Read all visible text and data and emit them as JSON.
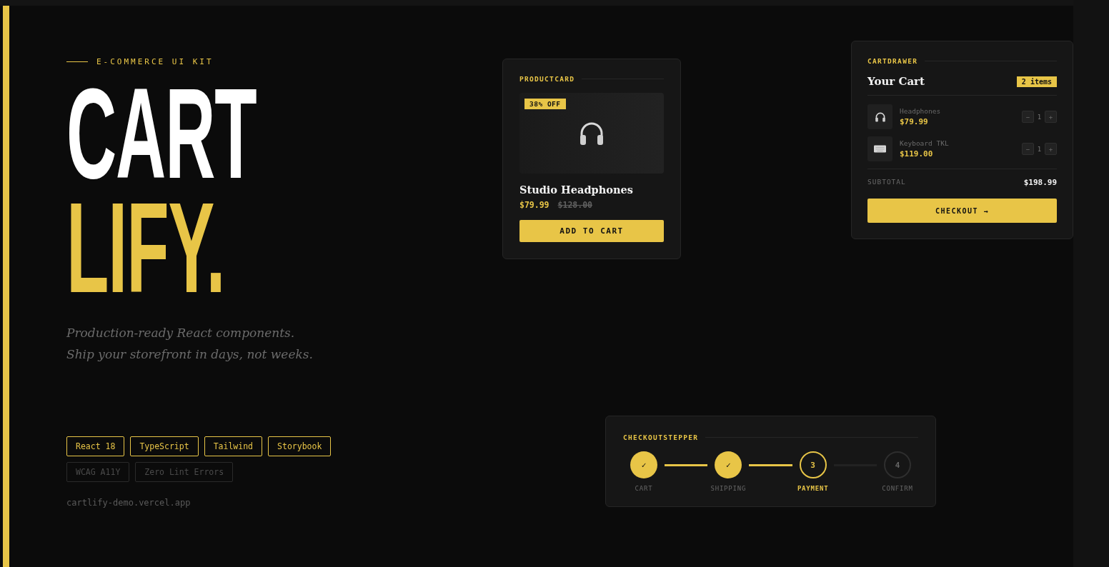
{
  "hero": {
    "eyebrow": "E-COMMERCE UI KIT",
    "title_lines": [
      {
        "text": "CART",
        "accent": false
      },
      {
        "text": "LIFY.",
        "accent": true
      }
    ],
    "tagline_lines": [
      "Production-ready React components.",
      "Ship your storefront in days, not weeks."
    ],
    "tags": [
      {
        "label": "React 18",
        "highlighted": true
      },
      {
        "label": "TypeScript",
        "highlighted": true
      },
      {
        "label": "Tailwind",
        "highlighted": true
      },
      {
        "label": "Storybook",
        "highlighted": true
      },
      {
        "label": "WCAG A11Y",
        "highlighted": false
      },
      {
        "label": "Zero Lint Errors",
        "highlighted": false
      }
    ],
    "url": "cartlify-demo.vercel.app"
  },
  "product_card": {
    "label": "PRODUCTCARD",
    "badge": "38% OFF",
    "name": "Studio Headphones",
    "price": "$79.99",
    "old_price": "$128.00",
    "button": "ADD TO CART"
  },
  "cart_drawer": {
    "label": "CARTDRAWER",
    "title": "Your Cart",
    "count": "2 items",
    "items": [
      {
        "kind": "headphones",
        "name": "Headphones",
        "price": "$79.99",
        "qty": "1",
        "minus": "−",
        "plus": "+"
      },
      {
        "kind": "keyboard",
        "name": "Keyboard TKL",
        "price": "$119.00",
        "qty": "1",
        "minus": "−",
        "plus": "+"
      }
    ],
    "subtotal_label": "SUBTOTAL",
    "subtotal": "$198.99",
    "button": "CHECKOUT →"
  },
  "stepper": {
    "label": "CHECKOUTSTEPPER",
    "steps": [
      {
        "mark": "✓",
        "label": "CART",
        "completed": true,
        "selected": false
      },
      {
        "mark": "✓",
        "label": "SHIPPING",
        "completed": true,
        "selected": false
      },
      {
        "mark": "3",
        "label": "PAYMENT",
        "completed": false,
        "selected": true
      },
      {
        "mark": "4",
        "label": "CONFIRM",
        "completed": false,
        "selected": false
      }
    ]
  }
}
